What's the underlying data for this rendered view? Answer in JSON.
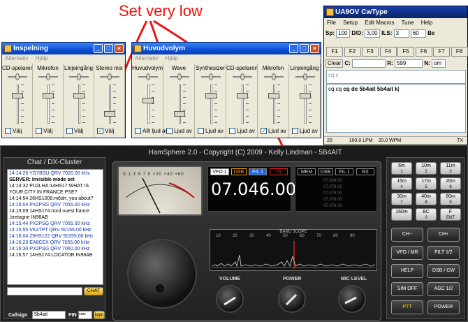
{
  "annotation": {
    "text": "Set very low"
  },
  "inspelning": {
    "title": "Inspelning",
    "menu": [
      "Alternativ",
      "Hjälp"
    ],
    "columns": [
      {
        "label": "CD-spelaren",
        "check": "Välj",
        "checked": false,
        "level": 0.75
      },
      {
        "label": "Mikrofon",
        "check": "Välj",
        "checked": false,
        "level": 0.75
      },
      {
        "label": "Linjeingång",
        "check": "Välj",
        "checked": false,
        "level": 0.75
      },
      {
        "label": "Stereo mix",
        "check": "Välj",
        "checked": true,
        "level": 0.2
      }
    ]
  },
  "huvudvolym": {
    "title": "Huvudvolym",
    "menu": [
      "Alternativ",
      "Hjälp"
    ],
    "columns": [
      {
        "label": "Huvudvolym",
        "check": "Allt ljud av",
        "checked": false,
        "level": 0.6
      },
      {
        "label": "Wave",
        "check": "Ljud av",
        "checked": false,
        "level": 0.2
      },
      {
        "label": "Synthesizer",
        "check": "Ljud av",
        "checked": false,
        "level": 0.75
      },
      {
        "label": "CD-spelaren",
        "check": "Ljud av",
        "checked": false,
        "level": 0.75
      },
      {
        "label": "Mikrofon",
        "check": "Ljud av",
        "checked": true,
        "level": 0.75
      },
      {
        "label": "Linjeingång",
        "check": "Ljud av",
        "checked": false,
        "level": 0.75
      }
    ]
  },
  "cwtype": {
    "title": "UA9OV CwType",
    "menu": [
      "File",
      "Setup",
      "Edit Macros",
      "Tune",
      "Help"
    ],
    "sp_label": "Sp:",
    "sp_value": "100",
    "dd_label": "D/D:",
    "dd_value": "3,00",
    "ils_label": "ILS:",
    "ils_value": "3",
    "extra_value": "60",
    "be_label": "Be",
    "fkeys": [
      "F1",
      "F2",
      "F3",
      "F4",
      "F5",
      "F6",
      "F7",
      "F8"
    ],
    "clear_label": "Clear",
    "c_label": "C:",
    "c_value": "",
    "r_label": "R:",
    "r_value": "599",
    "n_label": "N:",
    "n_value": "om",
    "rx_text": "cq c",
    "tx_text_prefix": "cq cq ",
    "tx_text_bold": "cq de 5b4ait 5b4ait k",
    "status": [
      "20",
      "100.0 LPM",
      "20.0 WPM",
      "TX"
    ]
  },
  "hamsphere": {
    "title": "HamSphere 2.0 - Copyright (C) 2009 - Kelly Lindman - 5B4AIT",
    "chat_title": "Chat / DX-Cluster",
    "chat_lines": [
      {
        "text": "14:14:26 YO7BSU QRV 7020.00 kHz",
        "style": "blue"
      },
      {
        "text": "SERVER: Invisible mode set",
        "style": "bold"
      },
      {
        "text": "14:14:32 PU2LHA:14HS17:WHAT IS YOUR CITY IN FRANCE PSE?",
        "style": "black"
      },
      {
        "text": "14:14:54 26HS1006:m6drr, you about?",
        "style": "black"
      },
      {
        "text": "14:15:04 PX2PSG QRV 7055.00 kHz",
        "style": "blue"
      },
      {
        "text": "14:15:09 14HS174:nord ouest france ,bretagne IN98AB",
        "style": "black"
      },
      {
        "text": "14:15:44 PX2PSG QRV 7055.00 kHz",
        "style": "blue"
      },
      {
        "text": "14:15:55 VK4TPT QRV 50155.00 kHz",
        "style": "blue"
      },
      {
        "text": "14:16:04 29HS122 QRV 50155.00 kHz",
        "style": "blue"
      },
      {
        "text": "14:16:23 EA8CEX QRV 7055.00 kHz",
        "style": "blue"
      },
      {
        "text": "14:16:30 PX2PSG QRV 7060.00 kHz",
        "style": "blue"
      },
      {
        "text": "14:16:57 14HS174:LOCATOR IN98AB",
        "style": "black"
      }
    ],
    "chat_button": "CHAT",
    "callsign_label": "Callsign",
    "callsign_value": "5b4ait",
    "pin_label": "PIN",
    "pin_value": "••••",
    "login_button": "login",
    "vfo_tags": [
      "VFO 1",
      "DSB",
      "FIL 1",
      "TX"
    ],
    "frequency": "07.046.00",
    "mem_tags": [
      "MEM",
      "DSB",
      "FIL 1",
      "RX"
    ],
    "mem_values": [
      "07.039.00",
      "07.078.00",
      "07.078.00",
      "07.078.00",
      "07.078.00"
    ],
    "bandscope_title": "BAND SCOPE",
    "scope_scale": [
      "10",
      "20",
      "30",
      "40",
      "50",
      "60",
      "70",
      "80",
      "90"
    ],
    "knobs": [
      "VOLUME",
      "POWER",
      "MIC LEVEL"
    ],
    "smeter_scale": "S 1 3 5 7 9 +20 +40 +60",
    "keypad_bands": [
      "6m",
      "10m",
      "11m",
      "15m",
      "17m",
      "20m",
      "30m",
      "40m",
      "80m",
      "160m",
      "BC",
      "F"
    ],
    "keypad_nums": [
      "1",
      "2",
      "3",
      "4",
      "5",
      "6",
      "7",
      "8",
      "9",
      "",
      "0",
      "ENT"
    ],
    "side_buttons": [
      [
        "CH−",
        "CH+"
      ],
      [
        "VFO / MR",
        "FILT 1/2"
      ],
      [
        "HELP",
        "DSB / CW"
      ],
      [
        "SIM OFF",
        "AGC 1/2"
      ],
      [
        "PTT",
        "POWER"
      ]
    ]
  }
}
